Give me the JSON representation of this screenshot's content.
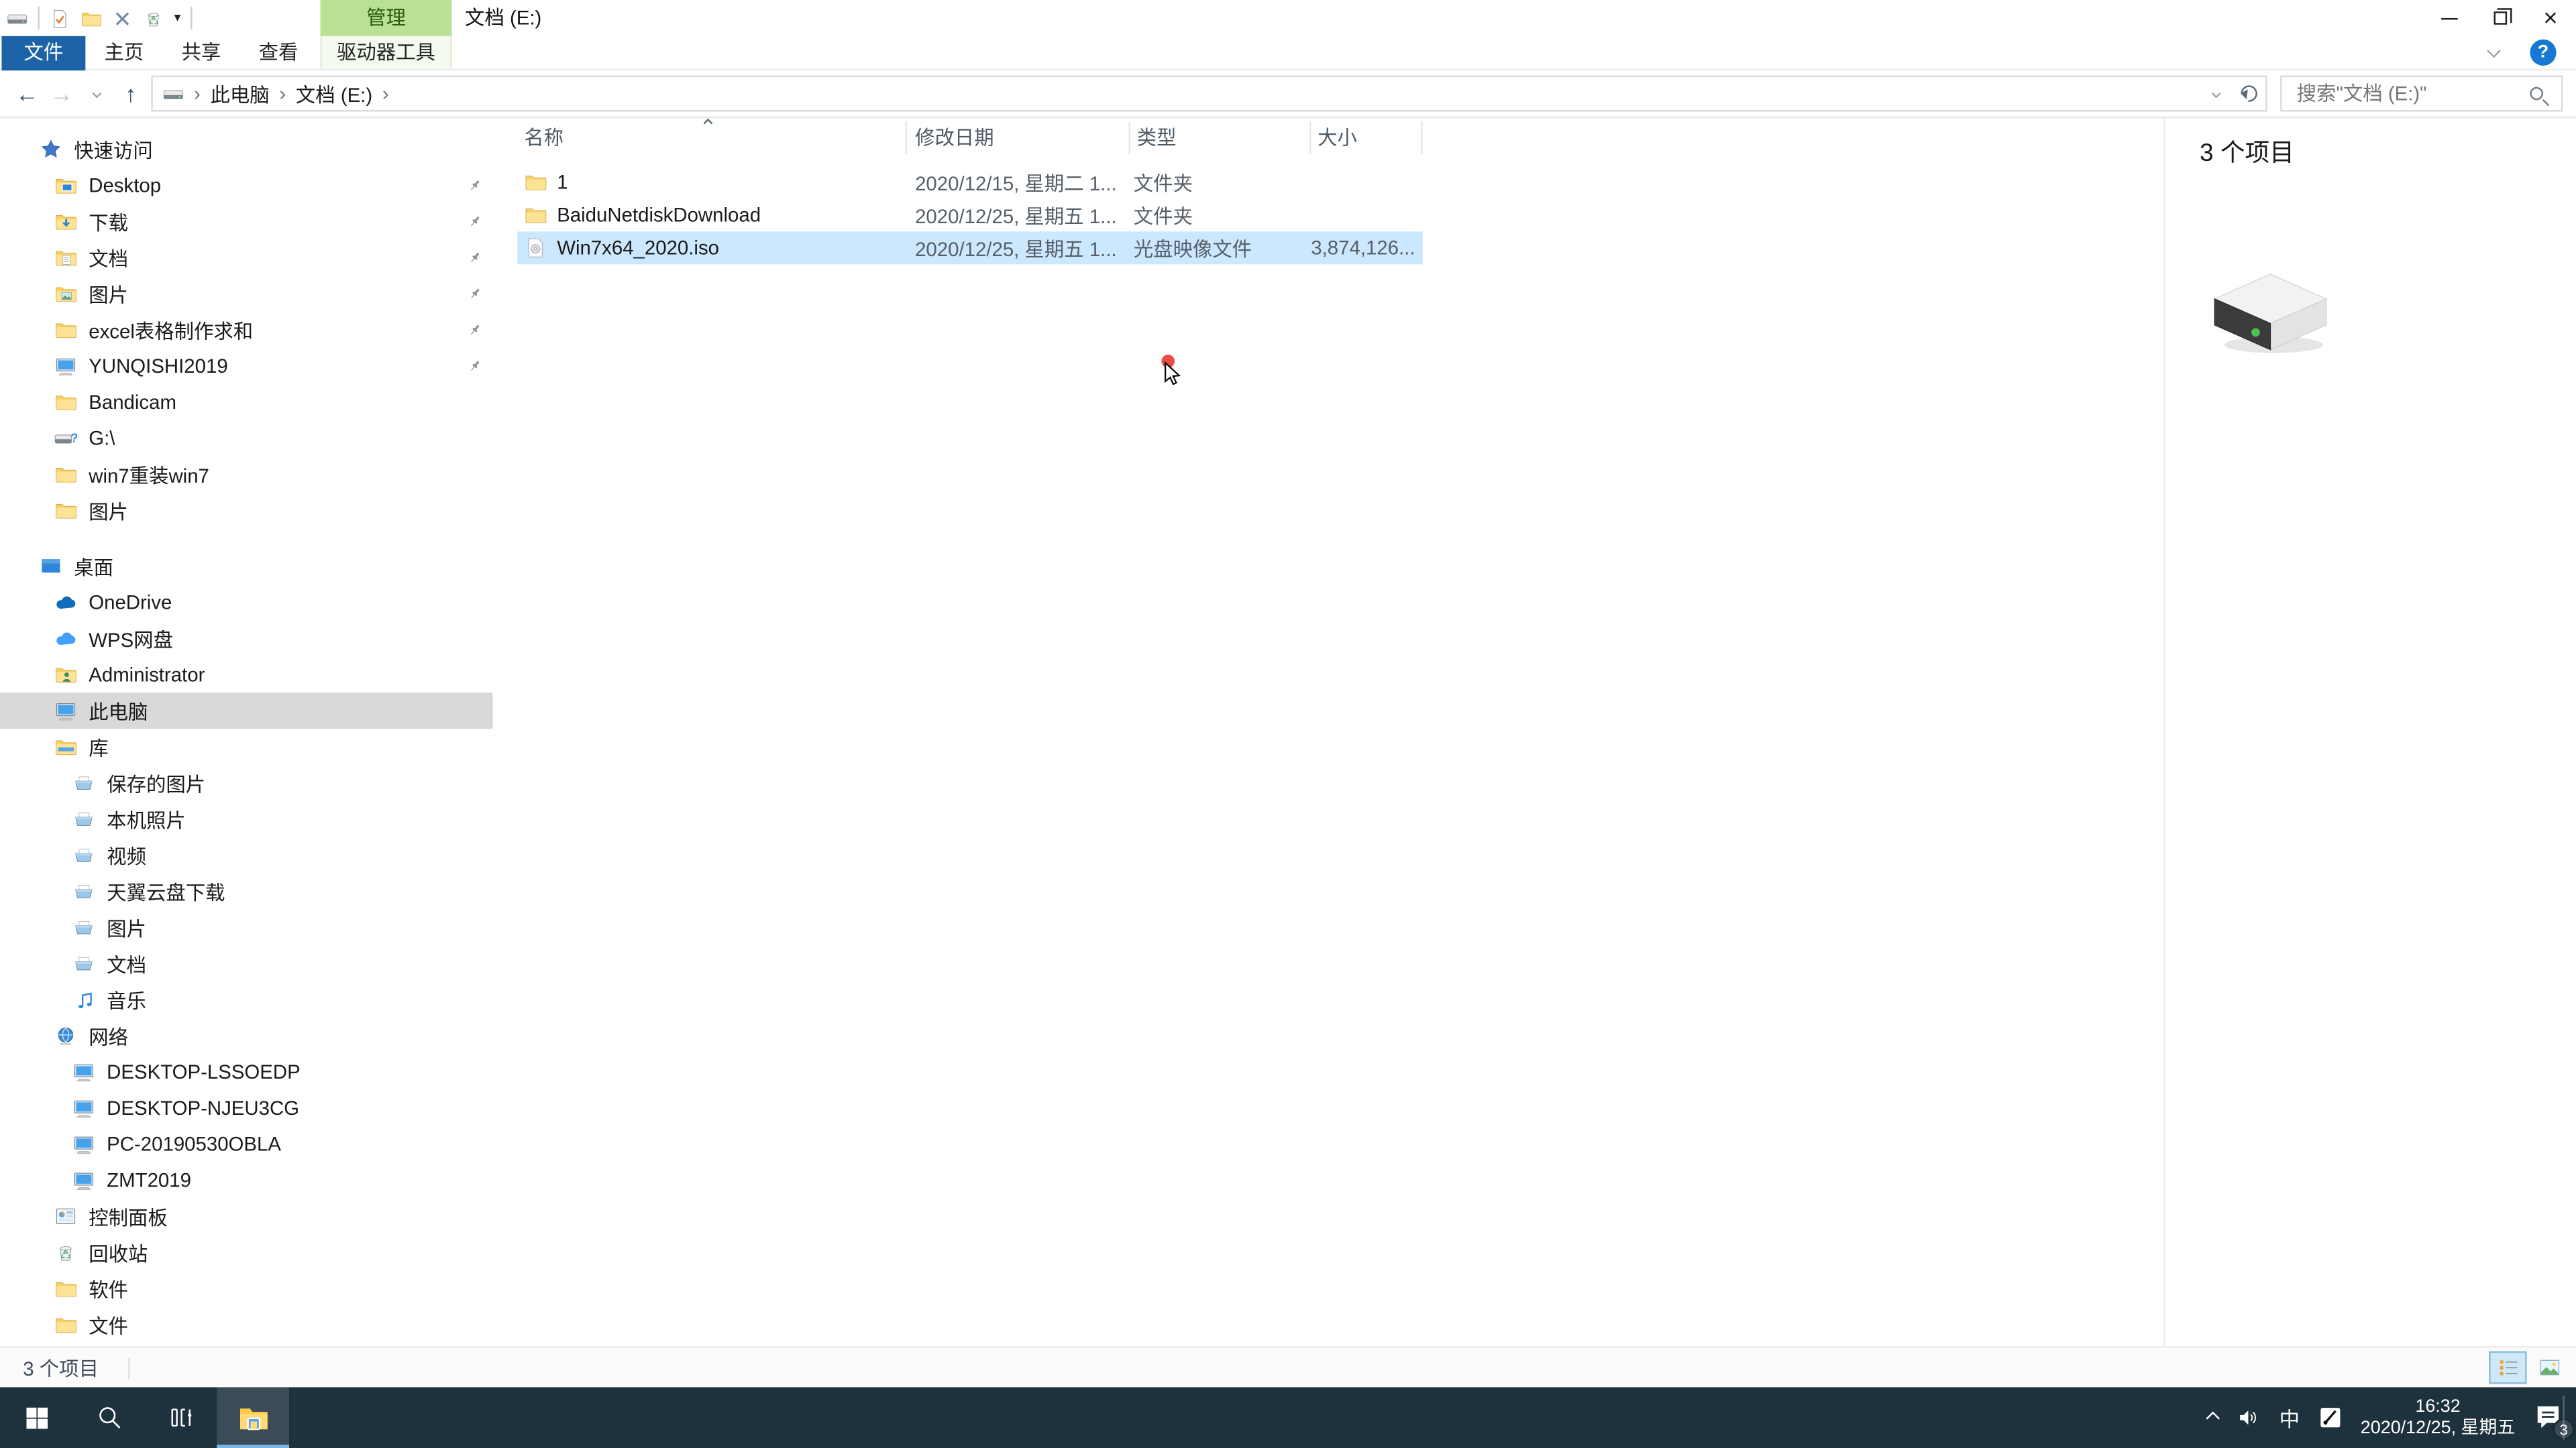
{
  "titlebar": {
    "contextual_tab": "管理",
    "title": "文档 (E:)"
  },
  "ribbon": {
    "file_tab": "文件",
    "tabs": [
      {
        "label": "主页"
      },
      {
        "label": "共享"
      },
      {
        "label": "查看"
      }
    ],
    "drive_tools_tab": "驱动器工具",
    "help": "?"
  },
  "icons": {
    "back_arrow": "←",
    "forward_arrow": "→",
    "up_arrow": "↑",
    "breadcrumb_separator": "›",
    "qat_menu_caret": "▾",
    "close": "×"
  },
  "addressbar": {
    "breadcrumb_root": "此电脑",
    "breadcrumb_current": "文档 (E:)",
    "search_placeholder": "搜索\"文档 (E:)\""
  },
  "sidebar": {
    "items": [
      {
        "label": "快速访问"
      },
      {
        "label": "Desktop"
      },
      {
        "label": "下载"
      },
      {
        "label": "文档"
      },
      {
        "label": "图片"
      },
      {
        "label": "excel表格制作求和"
      },
      {
        "label": "YUNQISHI2019"
      },
      {
        "label": "Bandicam"
      },
      {
        "label": "G:\\"
      },
      {
        "label": "win7重装win7"
      },
      {
        "label": "图片"
      },
      {
        "label": "桌面"
      },
      {
        "label": "OneDrive"
      },
      {
        "label": "WPS网盘"
      },
      {
        "label": "Administrator"
      },
      {
        "label": "此电脑"
      },
      {
        "label": "库"
      },
      {
        "label": "保存的图片"
      },
      {
        "label": "本机照片"
      },
      {
        "label": "视频"
      },
      {
        "label": "天翼云盘下载"
      },
      {
        "label": "图片"
      },
      {
        "label": "文档"
      },
      {
        "label": "音乐"
      },
      {
        "label": "网络"
      },
      {
        "label": "DESKTOP-LSSOEDP"
      },
      {
        "label": "DESKTOP-NJEU3CG"
      },
      {
        "label": "PC-20190530OBLA"
      },
      {
        "label": "ZMT2019"
      },
      {
        "label": "控制面板"
      },
      {
        "label": "回收站"
      },
      {
        "label": "软件"
      },
      {
        "label": "文件"
      }
    ]
  },
  "filelist": {
    "columns": [
      {
        "label": "名称"
      },
      {
        "label": "修改日期"
      },
      {
        "label": "类型"
      },
      {
        "label": "大小"
      }
    ],
    "rows": [
      {
        "name": "1",
        "date": "2020/12/15, 星期二 1...",
        "type": "文件夹",
        "size": ""
      },
      {
        "name": "BaiduNetdiskDownload",
        "date": "2020/12/25, 星期五 1...",
        "type": "文件夹",
        "size": ""
      },
      {
        "name": "Win7x64_2020.iso",
        "date": "2020/12/25, 星期五 1...",
        "type": "光盘映像文件",
        "size": "3,874,126..."
      }
    ]
  },
  "details_pane": {
    "item_count": "3 个项目"
  },
  "statusbar": {
    "item_count": "3 个项目"
  },
  "taskbar": {
    "time": "16:32",
    "date": "2020/12/25, 星期五",
    "ime": "中",
    "notification_badge": "3"
  }
}
